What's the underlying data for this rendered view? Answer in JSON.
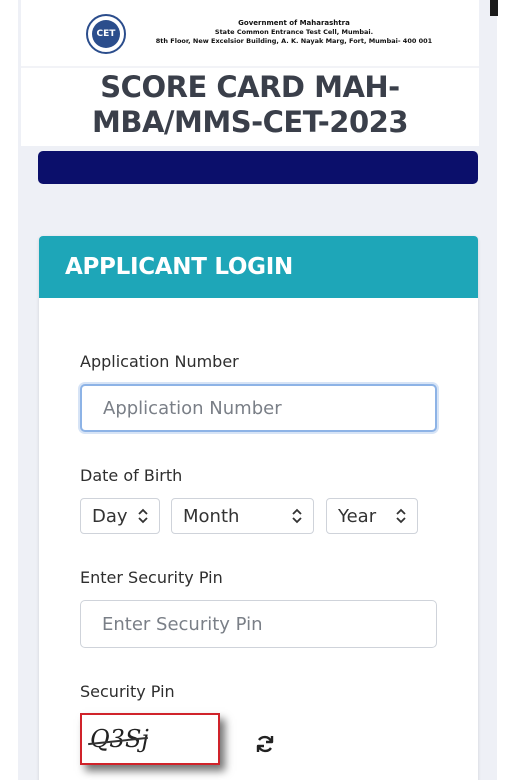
{
  "header": {
    "logo_text": "CET",
    "org_line1": "Government of Maharashtra",
    "org_line2": "State Common Entrance Test Cell, Mumbai.",
    "org_line3": "8th Floor, New Excelsior Building, A. K. Nayak Marg, Fort, Mumbai- 400 001",
    "title_line1": "SCORE CARD MAH-",
    "title_line2": "MBA/MMS-CET-2023"
  },
  "login": {
    "heading": "APPLICANT LOGIN",
    "application_number": {
      "label": "Application Number",
      "placeholder": "Application Number",
      "value": ""
    },
    "dob": {
      "label": "Date of Birth",
      "day": "Day",
      "month": "Month",
      "year": "Year"
    },
    "security_pin_input": {
      "label": "Enter Security Pin",
      "placeholder": "Enter Security Pin",
      "value": ""
    },
    "captcha": {
      "label": "Security Pin",
      "text": "Q3Sj"
    }
  },
  "colors": {
    "navbar": "#0b0f6b",
    "card_header": "#1ea6b8",
    "captcha_border": "#d0232a",
    "focus_ring": "#8db3e6"
  },
  "icons": {
    "select_arrows": "chevron-up-down-icon",
    "refresh": "refresh-icon"
  }
}
